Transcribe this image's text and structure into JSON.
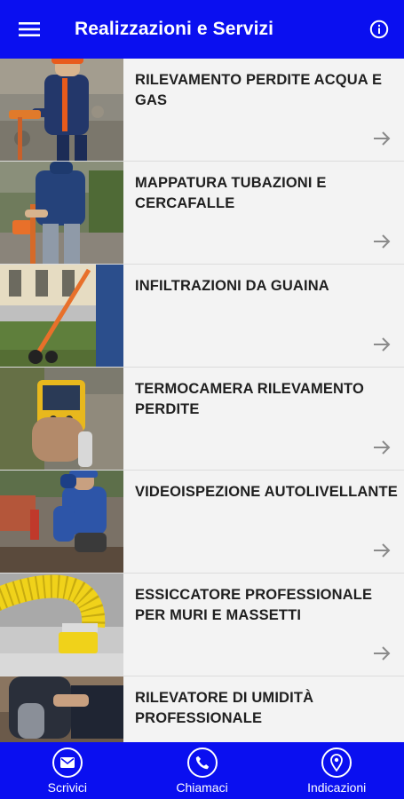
{
  "header": {
    "title": "Realizzazioni e Servizi",
    "menu_icon": "hamburger-menu-icon",
    "info_icon": "info-circle-icon"
  },
  "colors": {
    "brand": "#0a0ff0",
    "row_background": "#f3f3f3",
    "title_text": "#1f1f1f",
    "arrow": "#8a8a8a"
  },
  "services": [
    {
      "title": "RILEVAMENTO PERDITE ACQUA E GAS",
      "image": "technician-with-leak-detector-photo",
      "arrow_icon": "arrow-right-icon"
    },
    {
      "title": "MAPPATURA TUBAZIONI E CERCAFALLE",
      "image": "technician-with-pipe-locator-photo",
      "arrow_icon": "arrow-right-icon"
    },
    {
      "title": "INFILTRAZIONI DA GUAINA",
      "image": "wheeled-ground-probe-photo",
      "arrow_icon": "arrow-right-icon"
    },
    {
      "title": "TERMOCAMERA RILEVAMENTO PERDITE",
      "image": "thermal-camera-in-hand-photo",
      "arrow_icon": "arrow-right-icon"
    },
    {
      "title": "VIDEOISPEZIONE AUTOLIVELLANTE",
      "image": "workers-inspecting-manhole-photo",
      "arrow_icon": "arrow-right-icon"
    },
    {
      "title": "ESSICCATORE PROFESSIONALE PER MURI E MASSETTI",
      "image": "yellow-dryer-hose-photo",
      "arrow_icon": "arrow-right-icon"
    },
    {
      "title": "RILEVATORE DI UMIDITÀ PROFESSIONALE",
      "image": "kneeling-technician-photo",
      "arrow_icon": "arrow-right-icon"
    }
  ],
  "bottom_nav": [
    {
      "label": "Scrivici",
      "icon": "email-icon"
    },
    {
      "label": "Chiamaci",
      "icon": "phone-icon"
    },
    {
      "label": "Indicazioni",
      "icon": "map-pin-icon"
    }
  ]
}
